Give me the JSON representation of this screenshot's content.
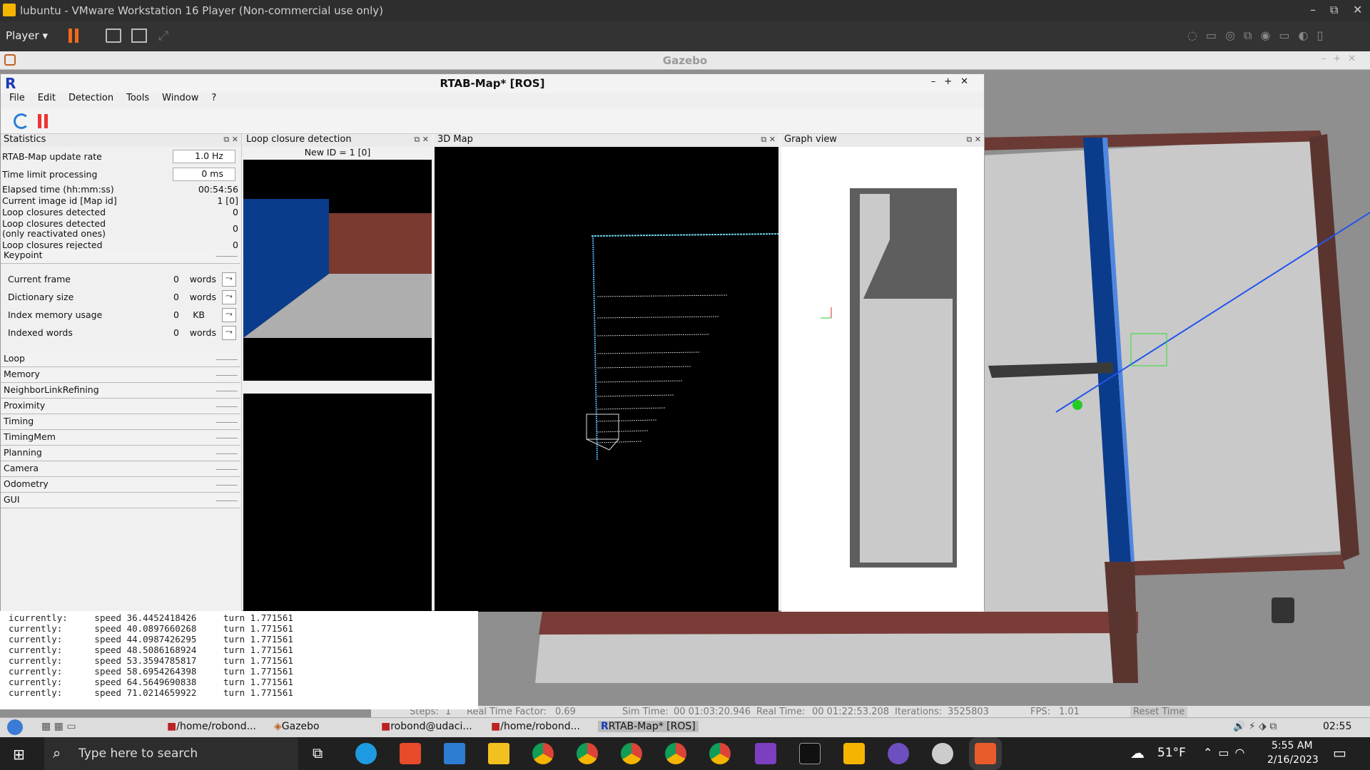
{
  "vm": {
    "title": "lubuntu - VMware Workstation 16 Player (Non-commercial use only)",
    "player_label": "Player",
    "minimize": "–",
    "restore": "⧉",
    "close": "✕"
  },
  "gazebo": {
    "title": "Gazebo",
    "status": {
      "steps_label": "Steps:",
      "steps": "1",
      "rtf_label": "Real Time Factor:",
      "rtf": "0.69",
      "sim_label": "Sim Time:",
      "sim": "00 01:03:20.946",
      "real_label": "Real Time:",
      "real": "00 01:22:53.208",
      "iter_label": "Iterations:",
      "iter": "3525803",
      "fps_label": "FPS:",
      "fps": "1.01",
      "reset": "Reset Time"
    }
  },
  "rtab": {
    "title": "RTAB-Map* [ROS]",
    "menu": [
      "File",
      "Edit",
      "Detection",
      "Tools",
      "Window",
      "?"
    ],
    "docks": {
      "stats": "Statistics",
      "loop": "Loop closure detection",
      "map": "3D Map",
      "graph": "Graph view"
    },
    "loop_new_id": "New ID = 1 [0]",
    "stats": {
      "update_rate_label": "RTAB-Map update rate",
      "update_rate": "1.0 Hz",
      "time_limit_label": "Time limit processing",
      "time_limit": "0 ms",
      "elapsed_label": "Elapsed time (hh:mm:ss)",
      "elapsed": "00:54:56",
      "image_id_label": "Current image id [Map id]",
      "image_id": "1 [0]",
      "loops_label": "Loop closures detected",
      "loops": "0",
      "reactivated_label1": "Loop closures detected",
      "reactivated_label2": "(only reactivated ones)",
      "reactivated": "0",
      "rejected_label": "Loop closures rejected",
      "rejected": "0",
      "keypoint_group": "Keypoint",
      "keypoint": [
        {
          "label": "Current frame",
          "value": "0",
          "unit": "words"
        },
        {
          "label": "Dictionary size",
          "value": "0",
          "unit": "words"
        },
        {
          "label": "Index memory usage",
          "value": "0",
          "unit": "KB"
        },
        {
          "label": "Indexed words",
          "value": "0",
          "unit": "words"
        }
      ],
      "groups": [
        "Loop",
        "Memory",
        "NeighborLinkRefining",
        "Proximity",
        "Timing",
        "TimingMem",
        "Planning",
        "Camera",
        "Odometry",
        "GUI"
      ]
    }
  },
  "terminal": {
    "lines": [
      "icurrently:\tspeed 36.4452418426\tturn 1.771561",
      "currently:\tspeed 40.0897660268\tturn 1.771561",
      "currently:\tspeed 44.0987426295\tturn 1.771561",
      "currently:\tspeed 48.5086168924\tturn 1.771561",
      "currently:\tspeed 53.3594785817\tturn 1.771561",
      "currently:\tspeed 58.6954264398\tturn 1.771561",
      "currently:\tspeed 64.5649690838\tturn 1.771561",
      "currently:\tspeed 71.0214659922\tturn 1.771561"
    ]
  },
  "lubuntu_taskbar": {
    "items": [
      "/home/robond...",
      "Gazebo",
      "robond@udaci...",
      "/home/robond...",
      "RTAB-Map* [ROS]"
    ],
    "clock": "02:55"
  },
  "windows_taskbar": {
    "search_placeholder": "Type here to search",
    "weather": "51°F",
    "time": "5:55 AM",
    "date": "2/16/2023"
  }
}
